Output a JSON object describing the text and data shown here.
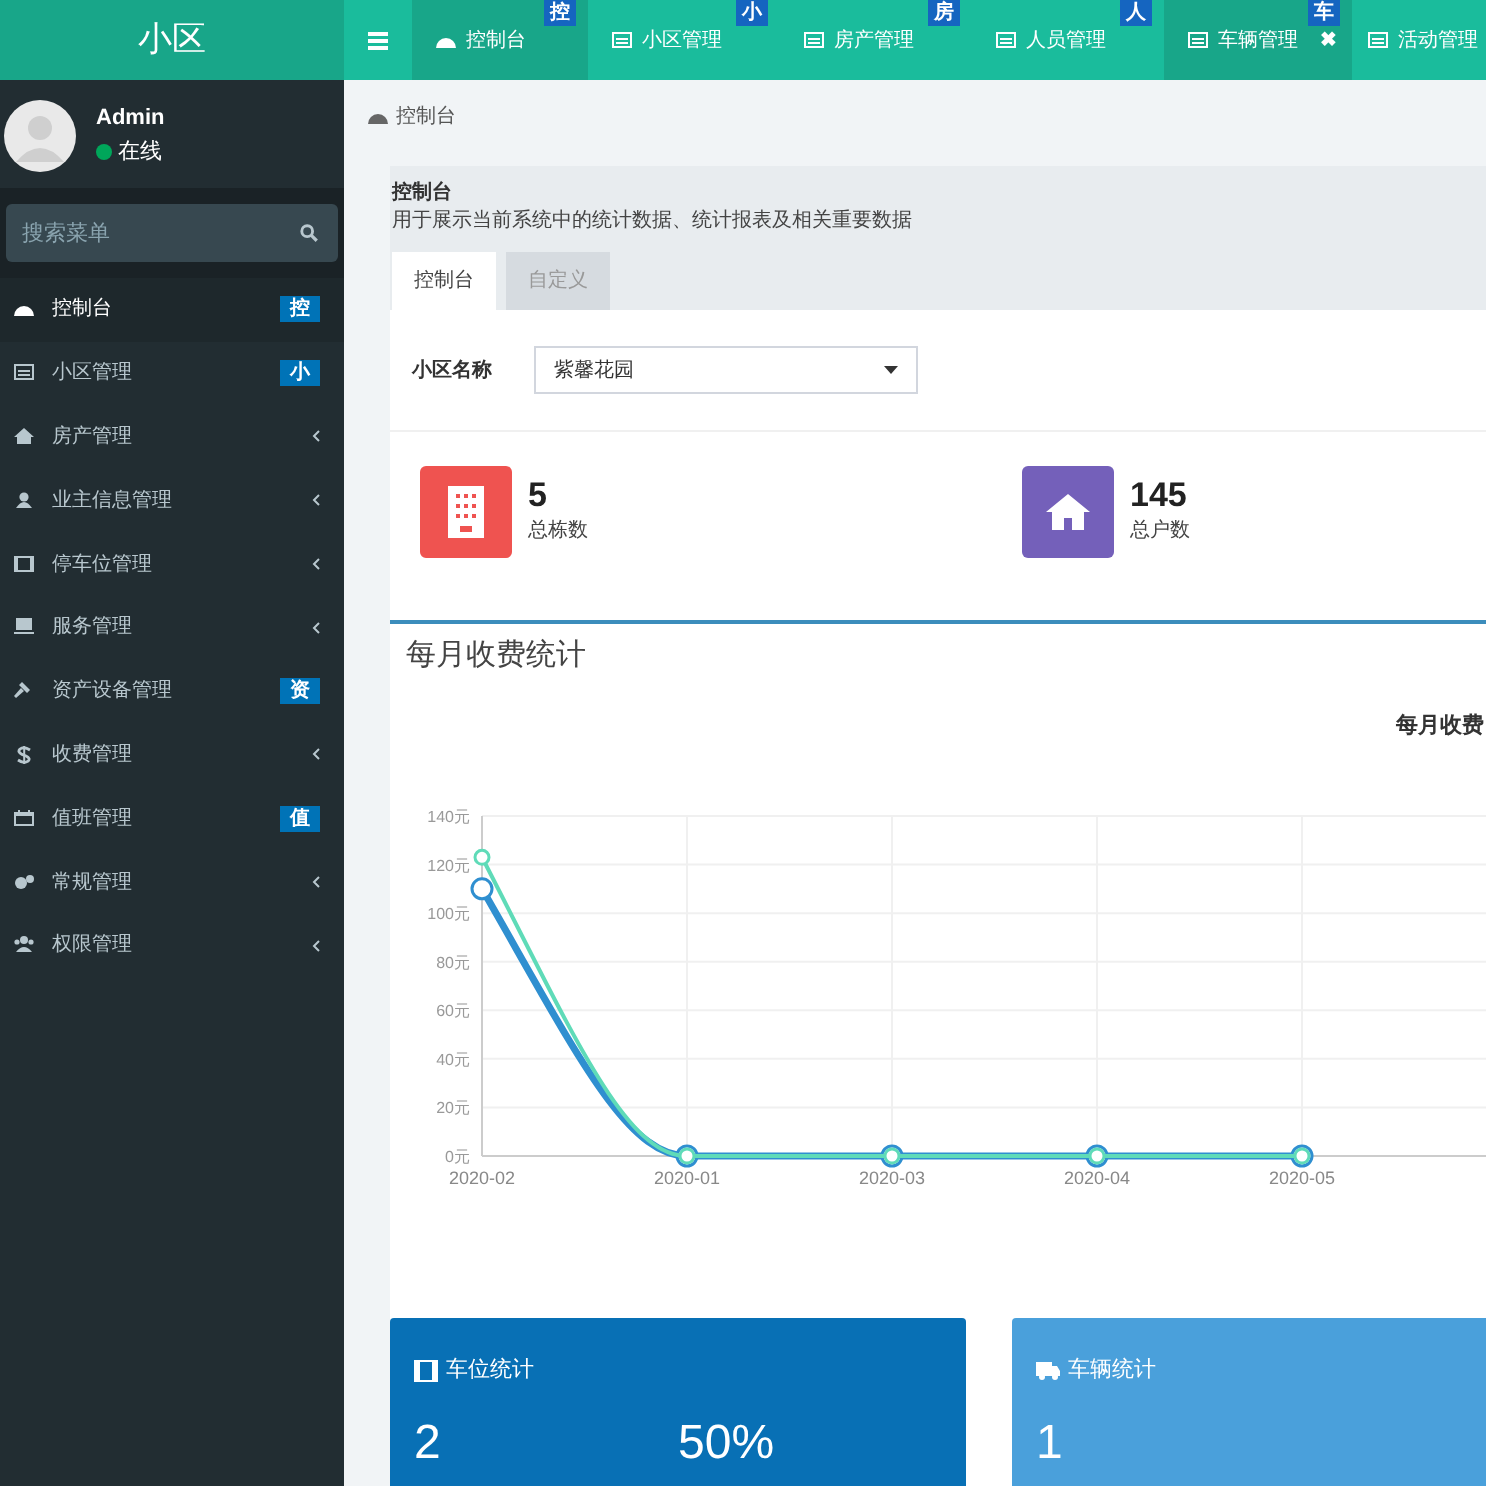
{
  "header": {
    "logo": "小区",
    "tabs": [
      {
        "label": "控制台",
        "badge": "控",
        "selected": true
      },
      {
        "label": "小区管理",
        "badge": "小",
        "selected": false
      },
      {
        "label": "房产管理",
        "badge": "房",
        "selected": false
      },
      {
        "label": "人员管理",
        "badge": "人",
        "selected": false
      },
      {
        "label": "车辆管理",
        "badge": "车",
        "selected": true,
        "close": "✖"
      },
      {
        "label": "活动管理",
        "selected": false
      }
    ]
  },
  "sidebar": {
    "user": {
      "name": "Admin",
      "status": "在线",
      "online": true
    },
    "search": {
      "placeholder": "搜索菜单"
    },
    "items": [
      {
        "label": "控制台",
        "badge": "控",
        "selected": true,
        "expandable": false
      },
      {
        "label": "小区管理",
        "badge": "小",
        "selected": false,
        "expandable": false
      },
      {
        "label": "房产管理",
        "selected": false,
        "expandable": true
      },
      {
        "label": "业主信息管理",
        "selected": false,
        "expandable": true
      },
      {
        "label": "停车位管理",
        "selected": false,
        "expandable": true
      },
      {
        "label": "服务管理",
        "selected": false,
        "expandable": true
      },
      {
        "label": "资产设备管理",
        "badge": "资",
        "selected": false,
        "expandable": false
      },
      {
        "label": "收费管理",
        "selected": false,
        "expandable": true
      },
      {
        "label": "值班管理",
        "badge": "值",
        "selected": false,
        "expandable": false
      },
      {
        "label": "常规管理",
        "selected": false,
        "expandable": true
      },
      {
        "label": "权限管理",
        "selected": false,
        "expandable": true
      }
    ]
  },
  "breadcrumb": "控制台",
  "page": {
    "title": "控制台",
    "description": "用于展示当前系统中的统计数据、统计报表及相关重要数据",
    "tabs": [
      {
        "label": "控制台",
        "selected": true
      },
      {
        "label": "自定义",
        "selected": false
      }
    ]
  },
  "filter": {
    "label": "小区名称",
    "value": "紫馨花园"
  },
  "stats": [
    {
      "value": "5",
      "label": "总栋数",
      "color": "#ef5350"
    },
    {
      "value": "145",
      "label": "总户数",
      "color": "#7460ba"
    }
  ],
  "panel": {
    "title": "每月收费统计",
    "chart_data": {
      "type": "line",
      "grid": true,
      "title": "每月收费",
      "categories": [
        "2020-02",
        "2020-01",
        "2020-03",
        "2020-04",
        "2020-05"
      ],
      "ylim": [
        0,
        140
      ],
      "yticks": [
        {
          "value": 0,
          "label": "0元"
        },
        {
          "value": 20,
          "label": "20元"
        },
        {
          "value": 40,
          "label": "40元"
        },
        {
          "value": 60,
          "label": "60元"
        },
        {
          "value": 80,
          "label": "80元"
        },
        {
          "value": 100,
          "label": "100元"
        },
        {
          "value": 120,
          "label": "120元"
        },
        {
          "value": 140,
          "label": "140元"
        }
      ],
      "series": [
        {
          "color": "#2f8fd0",
          "marker": "circle",
          "values": [
            110,
            0,
            0,
            0,
            0
          ]
        },
        {
          "color": "#5fdbb8",
          "marker": "circle",
          "values": [
            123,
            0,
            0,
            0,
            0
          ]
        }
      ]
    }
  },
  "cards": [
    {
      "title": "车位统计",
      "values": [
        "2",
        "50%"
      ],
      "color": "#0870b5"
    },
    {
      "title": "车辆统计",
      "values": [
        "1"
      ],
      "color": "#4aa0db"
    }
  ]
}
